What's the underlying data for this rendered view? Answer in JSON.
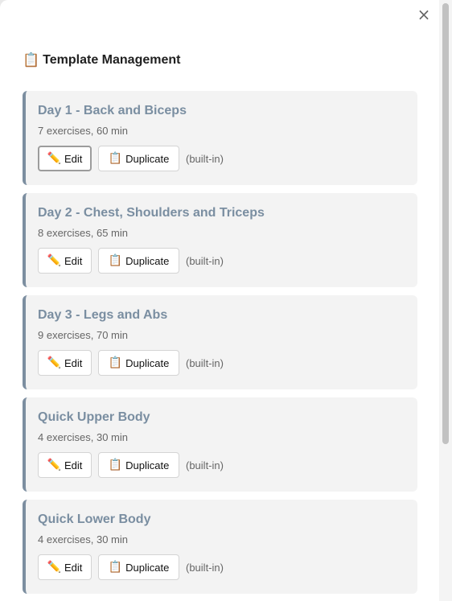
{
  "modal": {
    "close_label": "×",
    "title_icon": "📋",
    "title": "Template Management"
  },
  "templates": [
    {
      "name": "Day 1 - Back and Biceps",
      "meta": "7 exercises, 60 min",
      "edit_icon": "✏️",
      "edit_label": "Edit",
      "duplicate_icon": "📋",
      "duplicate_label": "Duplicate",
      "tag": "(built-in)"
    },
    {
      "name": "Day 2 - Chest, Shoulders and Triceps",
      "meta": "8 exercises, 65 min",
      "edit_icon": "✏️",
      "edit_label": "Edit",
      "duplicate_icon": "📋",
      "duplicate_label": "Duplicate",
      "tag": "(built-in)"
    },
    {
      "name": "Day 3 - Legs and Abs",
      "meta": "9 exercises, 70 min",
      "edit_icon": "✏️",
      "edit_label": "Edit",
      "duplicate_icon": "📋",
      "duplicate_label": "Duplicate",
      "tag": "(built-in)"
    },
    {
      "name": "Quick Upper Body",
      "meta": "4 exercises, 30 min",
      "edit_icon": "✏️",
      "edit_label": "Edit",
      "duplicate_icon": "📋",
      "duplicate_label": "Duplicate",
      "tag": "(built-in)"
    },
    {
      "name": "Quick Lower Body",
      "meta": "4 exercises, 30 min",
      "edit_icon": "✏️",
      "edit_label": "Edit",
      "duplicate_icon": "📋",
      "duplicate_label": "Duplicate",
      "tag": "(built-in)"
    }
  ],
  "colors": {
    "card_accent": "#7c8ea0",
    "card_title": "#7a8ea1",
    "card_background": "#f3f3f3"
  },
  "icons": {
    "close": "close-icon",
    "title": "clipboard-icon",
    "edit": "pencil-icon",
    "duplicate": "clipboard-icon"
  }
}
